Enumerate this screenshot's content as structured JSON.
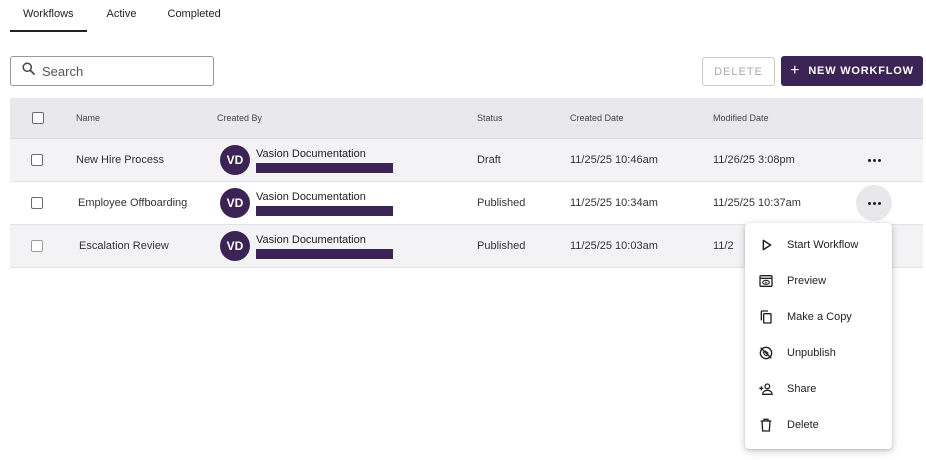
{
  "tabs": [
    {
      "label": "Workflows",
      "active": true
    },
    {
      "label": "Active",
      "active": false
    },
    {
      "label": "Completed",
      "active": false
    }
  ],
  "search": {
    "placeholder": "Search",
    "value": "",
    "icon": "search-icon"
  },
  "toolbar": {
    "delete_label": "DELETE",
    "new_label": "NEW WORKFLOW",
    "new_icon": "plus-icon"
  },
  "table": {
    "columns": [
      "Name",
      "Created By",
      "Status",
      "Created Date",
      "Modified Date"
    ],
    "rows": [
      {
        "name": "New Hire Process",
        "initials": "VD",
        "created_by": "Vasion Documentation",
        "status": "Draft",
        "created": "11/25/25 10:46am",
        "modified": "11/26/25 3:08pm"
      },
      {
        "name": "Employee Offboarding",
        "initials": "VD",
        "created_by": "Vasion Documentation",
        "status": "Published",
        "created": "11/25/25 10:34am",
        "modified": "11/25/25 10:37am"
      },
      {
        "name": "Escalation Review",
        "initials": "VD",
        "created_by": "Vasion Documentation",
        "status": "Published",
        "created": "11/25/25 10:03am",
        "modified": "11/2"
      }
    ]
  },
  "menu": {
    "items": [
      {
        "label": "Start Workflow",
        "icon": "play-icon"
      },
      {
        "label": "Preview",
        "icon": "preview-icon"
      },
      {
        "label": "Make a Copy",
        "icon": "copy-icon"
      },
      {
        "label": "Unpublish",
        "icon": "unpublish-icon"
      },
      {
        "label": "Share",
        "icon": "share-person-icon"
      },
      {
        "label": "Delete",
        "icon": "trash-icon"
      }
    ]
  },
  "colors": {
    "brand": "#3b2455",
    "header_bg": "#e9e8ed",
    "alt_row_bg": "#f3f3f5"
  }
}
